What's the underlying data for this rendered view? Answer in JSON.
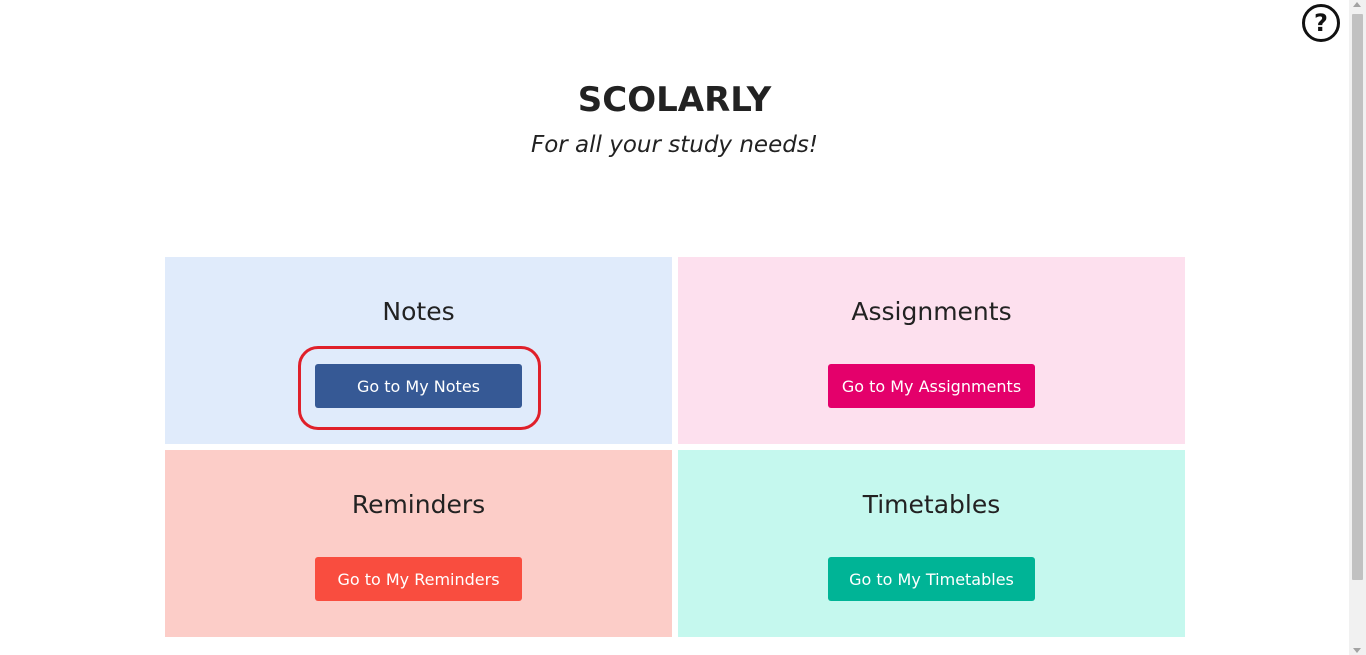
{
  "header": {
    "title": "SCOLARLY",
    "subtitle": "For all your study needs!"
  },
  "help": {
    "label": "?",
    "icon": "question-circle-icon"
  },
  "cards": [
    {
      "title": "Notes",
      "button_label": "Go to My Notes",
      "bg_color": "#e0ebfb",
      "button_color": "#365995",
      "highlighted": true
    },
    {
      "title": "Assignments",
      "button_label": "Go to My Assignments",
      "bg_color": "#fde0ee",
      "button_color": "#e4006b",
      "highlighted": false
    },
    {
      "title": "Reminders",
      "button_label": "Go to My Reminders",
      "bg_color": "#fccdc8",
      "button_color": "#f94d3f",
      "highlighted": false
    },
    {
      "title": "Timetables",
      "button_label": "Go to My Timetables",
      "bg_color": "#c5f8ee",
      "button_color": "#00b496",
      "highlighted": false
    }
  ],
  "colors": {
    "highlight_ring": "#e0202a",
    "text": "#222222"
  }
}
